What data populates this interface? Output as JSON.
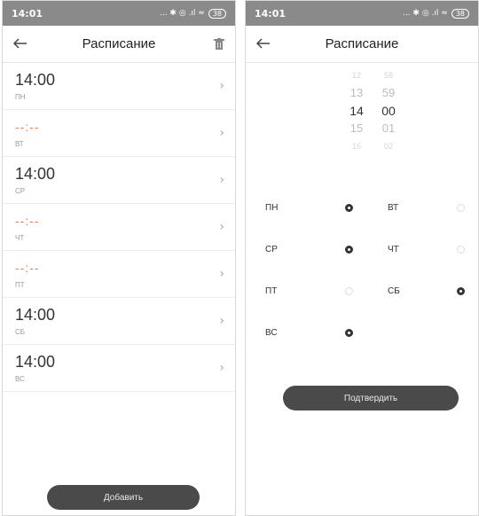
{
  "status": {
    "left_time": "14:01",
    "right_time": "14:01",
    "battery": "38",
    "signals": "... ✱ ◎ .ıl ≈"
  },
  "list_screen": {
    "title": "Расписание",
    "icons": {
      "back": "arrow-left-icon",
      "delete": "trash-icon",
      "chevron": "chevron-right-icon"
    },
    "rows": [
      {
        "time": "14:00",
        "day": "ПН",
        "set": true
      },
      {
        "time": "--:--",
        "day": "ВТ",
        "set": false
      },
      {
        "time": "14:00",
        "day": "СР",
        "set": true
      },
      {
        "time": "--:--",
        "day": "ЧТ",
        "set": false
      },
      {
        "time": "--:--",
        "day": "ПТ",
        "set": false
      },
      {
        "time": "14:00",
        "day": "СБ",
        "set": true
      },
      {
        "time": "14:00",
        "day": "ВС",
        "set": true
      }
    ],
    "add_label": "Добавить"
  },
  "edit_screen": {
    "title": "Расписание",
    "picker": {
      "hours": [
        "12",
        "13",
        "14",
        "15",
        "16"
      ],
      "minutes": [
        "58",
        "59",
        "00",
        "01",
        "02"
      ],
      "selected_hour": "14",
      "selected_minute": "00"
    },
    "days": [
      {
        "label": "ПН",
        "checked": true
      },
      {
        "label": "ВТ",
        "checked": false
      },
      {
        "label": "СР",
        "checked": true
      },
      {
        "label": "ЧТ",
        "checked": false
      },
      {
        "label": "ПТ",
        "checked": false
      },
      {
        "label": "СБ",
        "checked": true
      },
      {
        "label": "ВС",
        "checked": true
      }
    ],
    "confirm_label": "Подтвердить"
  },
  "colors": {
    "accent_empty": "#d9826b",
    "button": "#4a4a4a",
    "statusbar": "#8a8a8a"
  }
}
